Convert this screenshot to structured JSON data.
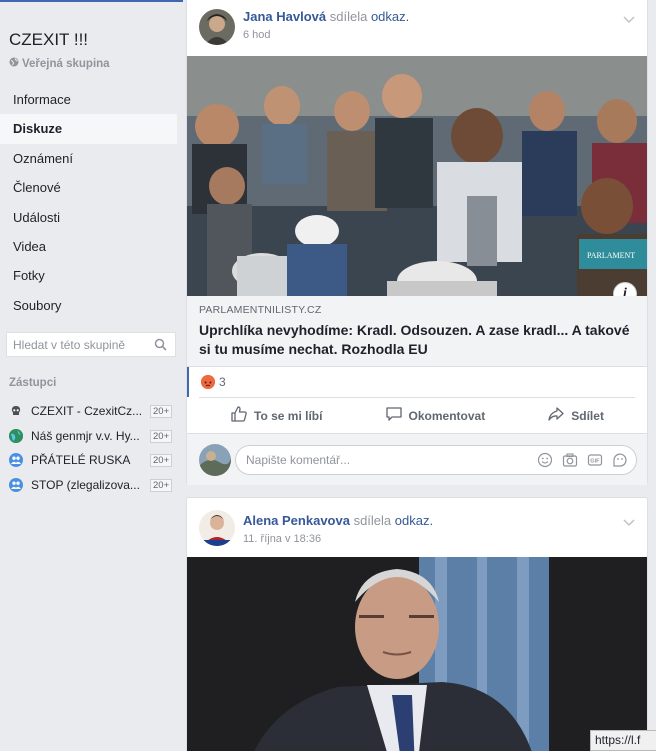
{
  "group": {
    "title": "CZEXIT !!!",
    "privacy": "Veřejná skupina"
  },
  "nav": {
    "items": [
      "Informace",
      "Diskuze",
      "Oznámení",
      "Členové",
      "Události",
      "Videa",
      "Fotky",
      "Soubory"
    ],
    "active": "Diskuze"
  },
  "search": {
    "placeholder": "Hledat v této skupině"
  },
  "representatives": {
    "label": "Zástupci",
    "items": [
      {
        "name": "CZEXIT - CzexitCz...",
        "badge": "20+"
      },
      {
        "name": "Náš genmjr v.v. Hy...",
        "badge": "20+"
      },
      {
        "name": "PŘÁTELÉ RUSKA",
        "badge": "20+"
      },
      {
        "name": "STOP (zlegalizova...",
        "badge": "20+"
      }
    ]
  },
  "post1": {
    "author": "Jana Havlová",
    "action": "sdílela",
    "object": "odkaz.",
    "time": "6 hod",
    "photo_watermark": "PARLAMENT",
    "link_domain": "PARLAMENTNILISTY.CZ",
    "link_title": "Uprchlíka nevyhodíme: Kradl. Odsouzen. A zase kradl... A takové si tu musíme nechat. Rozhodla EU",
    "reaction_count": "3",
    "actions": {
      "like": "To se mi líbí",
      "comment": "Okomentovat",
      "share": "Sdílet"
    },
    "comment_placeholder": "Napište komentář..."
  },
  "post2": {
    "author": "Alena Penkavova",
    "action": "sdílela",
    "object": "odkaz.",
    "time": "11. října v 18:36"
  },
  "status_bar": {
    "url": "https://l.f"
  },
  "colors": {
    "brand": "#4267b2",
    "link": "#365899",
    "page_bg": "#e9ebee",
    "angry": "#f0683f"
  }
}
